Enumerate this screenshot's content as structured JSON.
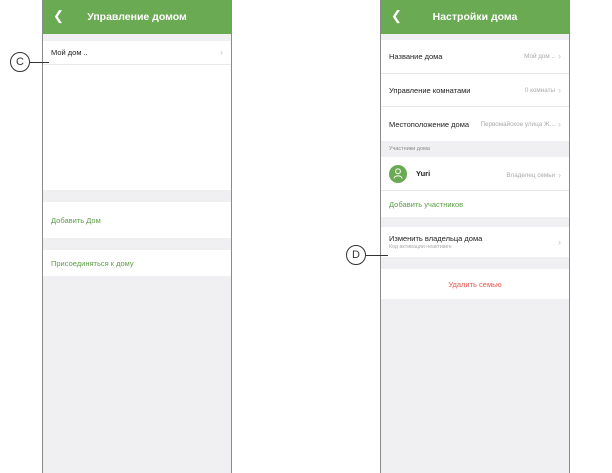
{
  "left": {
    "title": "Управление домом",
    "home_item": "Мой дом ..",
    "add_home": "Добавить Дом",
    "join_home": "Присоединяться к дому",
    "callout": "C"
  },
  "right": {
    "title": "Настройки дома",
    "rows": [
      {
        "label": "Название дома",
        "value": "Мой дом .."
      },
      {
        "label": "Управление комнатами",
        "value": "0 комнаты"
      },
      {
        "label": "Местоположение дома",
        "value": "Первомайское улица Ж..."
      }
    ],
    "members_section": "Участники дома",
    "member_name": "Yuri",
    "member_role": "Владелец семьи",
    "add_members": "Добавить участников",
    "change_owner": "Изменить владельца дома",
    "change_owner_sub": "Код активации неактивен",
    "delete_family": "Удалить семью",
    "callout": "D"
  },
  "colors": {
    "header": "#6aaa52",
    "accent_green": "#5c9e45",
    "danger": "#e0584e"
  }
}
